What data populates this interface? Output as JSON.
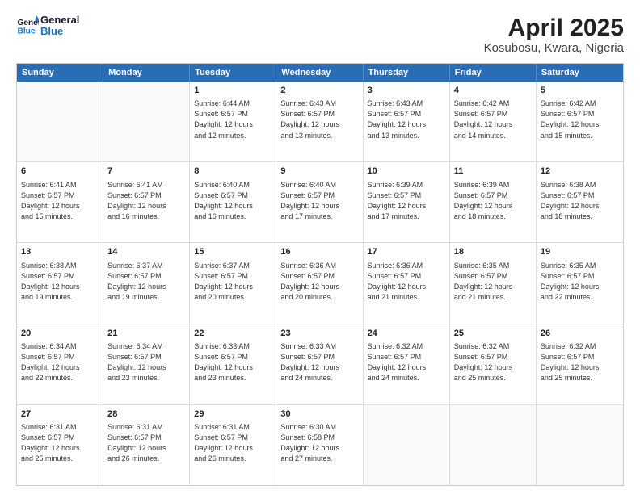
{
  "header": {
    "logo_line1": "General",
    "logo_line2": "Blue",
    "title": "April 2025",
    "subtitle": "Kosubosu, Kwara, Nigeria"
  },
  "days": [
    "Sunday",
    "Monday",
    "Tuesday",
    "Wednesday",
    "Thursday",
    "Friday",
    "Saturday"
  ],
  "weeks": [
    [
      {
        "num": "",
        "lines": []
      },
      {
        "num": "",
        "lines": []
      },
      {
        "num": "1",
        "lines": [
          "Sunrise: 6:44 AM",
          "Sunset: 6:57 PM",
          "Daylight: 12 hours",
          "and 12 minutes."
        ]
      },
      {
        "num": "2",
        "lines": [
          "Sunrise: 6:43 AM",
          "Sunset: 6:57 PM",
          "Daylight: 12 hours",
          "and 13 minutes."
        ]
      },
      {
        "num": "3",
        "lines": [
          "Sunrise: 6:43 AM",
          "Sunset: 6:57 PM",
          "Daylight: 12 hours",
          "and 13 minutes."
        ]
      },
      {
        "num": "4",
        "lines": [
          "Sunrise: 6:42 AM",
          "Sunset: 6:57 PM",
          "Daylight: 12 hours",
          "and 14 minutes."
        ]
      },
      {
        "num": "5",
        "lines": [
          "Sunrise: 6:42 AM",
          "Sunset: 6:57 PM",
          "Daylight: 12 hours",
          "and 15 minutes."
        ]
      }
    ],
    [
      {
        "num": "6",
        "lines": [
          "Sunrise: 6:41 AM",
          "Sunset: 6:57 PM",
          "Daylight: 12 hours",
          "and 15 minutes."
        ]
      },
      {
        "num": "7",
        "lines": [
          "Sunrise: 6:41 AM",
          "Sunset: 6:57 PM",
          "Daylight: 12 hours",
          "and 16 minutes."
        ]
      },
      {
        "num": "8",
        "lines": [
          "Sunrise: 6:40 AM",
          "Sunset: 6:57 PM",
          "Daylight: 12 hours",
          "and 16 minutes."
        ]
      },
      {
        "num": "9",
        "lines": [
          "Sunrise: 6:40 AM",
          "Sunset: 6:57 PM",
          "Daylight: 12 hours",
          "and 17 minutes."
        ]
      },
      {
        "num": "10",
        "lines": [
          "Sunrise: 6:39 AM",
          "Sunset: 6:57 PM",
          "Daylight: 12 hours",
          "and 17 minutes."
        ]
      },
      {
        "num": "11",
        "lines": [
          "Sunrise: 6:39 AM",
          "Sunset: 6:57 PM",
          "Daylight: 12 hours",
          "and 18 minutes."
        ]
      },
      {
        "num": "12",
        "lines": [
          "Sunrise: 6:38 AM",
          "Sunset: 6:57 PM",
          "Daylight: 12 hours",
          "and 18 minutes."
        ]
      }
    ],
    [
      {
        "num": "13",
        "lines": [
          "Sunrise: 6:38 AM",
          "Sunset: 6:57 PM",
          "Daylight: 12 hours",
          "and 19 minutes."
        ]
      },
      {
        "num": "14",
        "lines": [
          "Sunrise: 6:37 AM",
          "Sunset: 6:57 PM",
          "Daylight: 12 hours",
          "and 19 minutes."
        ]
      },
      {
        "num": "15",
        "lines": [
          "Sunrise: 6:37 AM",
          "Sunset: 6:57 PM",
          "Daylight: 12 hours",
          "and 20 minutes."
        ]
      },
      {
        "num": "16",
        "lines": [
          "Sunrise: 6:36 AM",
          "Sunset: 6:57 PM",
          "Daylight: 12 hours",
          "and 20 minutes."
        ]
      },
      {
        "num": "17",
        "lines": [
          "Sunrise: 6:36 AM",
          "Sunset: 6:57 PM",
          "Daylight: 12 hours",
          "and 21 minutes."
        ]
      },
      {
        "num": "18",
        "lines": [
          "Sunrise: 6:35 AM",
          "Sunset: 6:57 PM",
          "Daylight: 12 hours",
          "and 21 minutes."
        ]
      },
      {
        "num": "19",
        "lines": [
          "Sunrise: 6:35 AM",
          "Sunset: 6:57 PM",
          "Daylight: 12 hours",
          "and 22 minutes."
        ]
      }
    ],
    [
      {
        "num": "20",
        "lines": [
          "Sunrise: 6:34 AM",
          "Sunset: 6:57 PM",
          "Daylight: 12 hours",
          "and 22 minutes."
        ]
      },
      {
        "num": "21",
        "lines": [
          "Sunrise: 6:34 AM",
          "Sunset: 6:57 PM",
          "Daylight: 12 hours",
          "and 23 minutes."
        ]
      },
      {
        "num": "22",
        "lines": [
          "Sunrise: 6:33 AM",
          "Sunset: 6:57 PM",
          "Daylight: 12 hours",
          "and 23 minutes."
        ]
      },
      {
        "num": "23",
        "lines": [
          "Sunrise: 6:33 AM",
          "Sunset: 6:57 PM",
          "Daylight: 12 hours",
          "and 24 minutes."
        ]
      },
      {
        "num": "24",
        "lines": [
          "Sunrise: 6:32 AM",
          "Sunset: 6:57 PM",
          "Daylight: 12 hours",
          "and 24 minutes."
        ]
      },
      {
        "num": "25",
        "lines": [
          "Sunrise: 6:32 AM",
          "Sunset: 6:57 PM",
          "Daylight: 12 hours",
          "and 25 minutes."
        ]
      },
      {
        "num": "26",
        "lines": [
          "Sunrise: 6:32 AM",
          "Sunset: 6:57 PM",
          "Daylight: 12 hours",
          "and 25 minutes."
        ]
      }
    ],
    [
      {
        "num": "27",
        "lines": [
          "Sunrise: 6:31 AM",
          "Sunset: 6:57 PM",
          "Daylight: 12 hours",
          "and 25 minutes."
        ]
      },
      {
        "num": "28",
        "lines": [
          "Sunrise: 6:31 AM",
          "Sunset: 6:57 PM",
          "Daylight: 12 hours",
          "and 26 minutes."
        ]
      },
      {
        "num": "29",
        "lines": [
          "Sunrise: 6:31 AM",
          "Sunset: 6:57 PM",
          "Daylight: 12 hours",
          "and 26 minutes."
        ]
      },
      {
        "num": "30",
        "lines": [
          "Sunrise: 6:30 AM",
          "Sunset: 6:58 PM",
          "Daylight: 12 hours",
          "and 27 minutes."
        ]
      },
      {
        "num": "",
        "lines": []
      },
      {
        "num": "",
        "lines": []
      },
      {
        "num": "",
        "lines": []
      }
    ]
  ]
}
